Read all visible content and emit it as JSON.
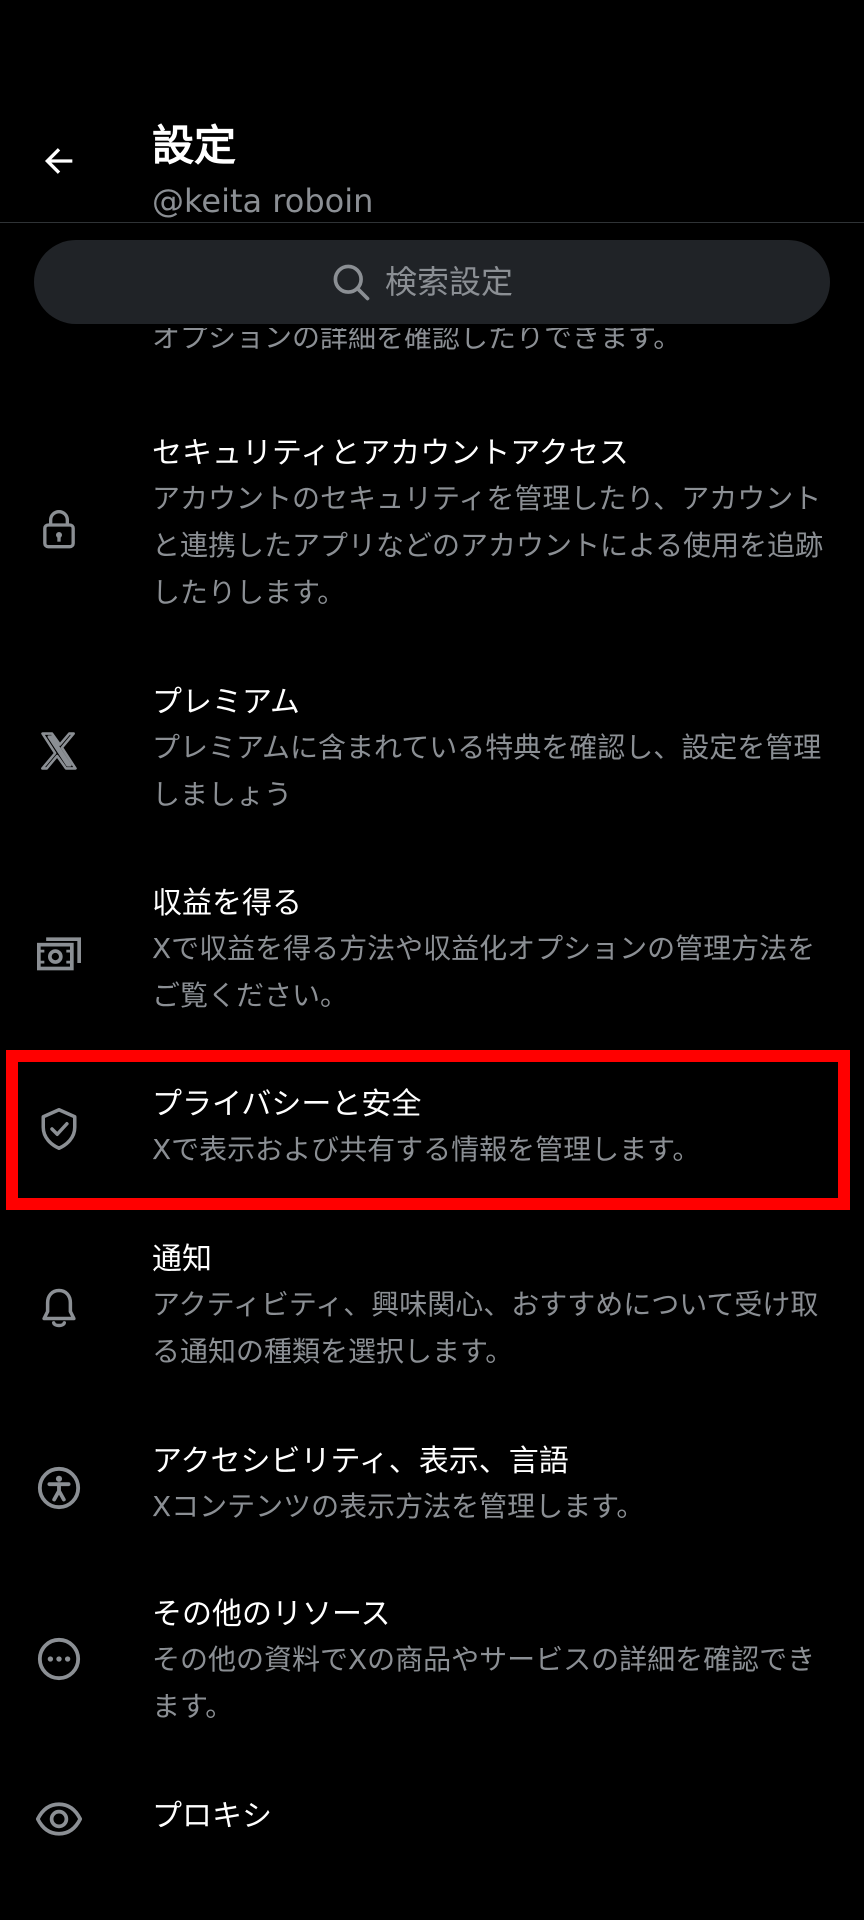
{
  "header": {
    "title": "設定",
    "subtitle": "@keita roboin"
  },
  "search": {
    "placeholder": "検索設定"
  },
  "partial_item": {
    "description": "オプションの詳細を確認したりできます。"
  },
  "items": [
    {
      "title": "セキュリティとアカウントアクセス",
      "description": "アカウントのセキュリティを管理したり、アカウントと連携したアプリなどのアカウントによる使用を追跡したりします。",
      "icon": "lock-icon"
    },
    {
      "title": "プレミアム",
      "description": "プレミアムに含まれている特典を確認し、設定を管理しましょう",
      "icon": "x-logo-icon"
    },
    {
      "title": "収益を得る",
      "description": "Xで収益を得る方法や収益化オプションの管理方法をご覧ください。",
      "icon": "money-icon"
    },
    {
      "title": "プライバシーと安全",
      "description": "Xで表示および共有する情報を管理します。",
      "icon": "shield-check-icon"
    },
    {
      "title": "通知",
      "description": "アクティビティ、興味関心、おすすめについて受け取る通知の種類を選択します。",
      "icon": "bell-icon"
    },
    {
      "title": "アクセシビリティ、表示、言語",
      "description": "Xコンテンツの表示方法を管理します。",
      "icon": "accessibility-icon"
    },
    {
      "title": "その他のリソース",
      "description": "その他の資料でXの商品やサービスの詳細を確認できます。",
      "icon": "more-circle-icon"
    },
    {
      "title": "プロキシ",
      "description": "",
      "icon": "eye-icon"
    }
  ],
  "colors": {
    "background": "#000000",
    "title": "#ffffff",
    "secondary": "#8b8f94",
    "search_bg": "#202327",
    "highlight": "#ff0000"
  }
}
